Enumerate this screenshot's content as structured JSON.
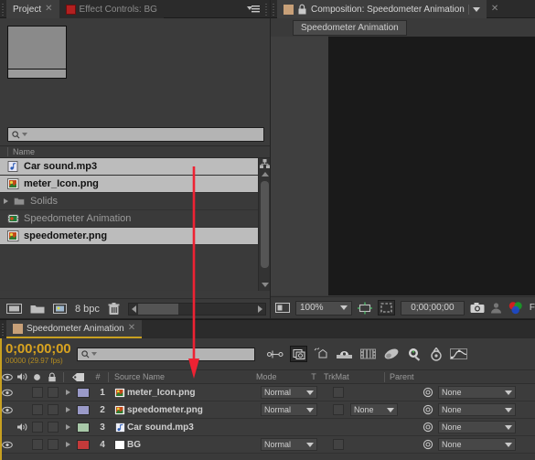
{
  "project": {
    "tabs": [
      {
        "label": "Project",
        "closable": true,
        "active": true,
        "icon": null
      },
      {
        "label": "Effect Controls: BG",
        "closable": false,
        "active": false,
        "icon": "red-square-icon"
      }
    ],
    "panel_menu_icon": "panel-menu-icon",
    "search": {
      "placeholder": "",
      "value": "",
      "icon": "search-icon"
    },
    "column_header": "Name",
    "items": [
      {
        "name": "Car sound.mp3",
        "icon": "audio-file-icon",
        "selected": true,
        "folder": false
      },
      {
        "name": "meter_Icon.png",
        "icon": "image-file-icon",
        "selected": true,
        "folder": false
      },
      {
        "name": "Solids",
        "icon": "folder-icon",
        "selected": false,
        "folder": true
      },
      {
        "name": "Speedometer Animation",
        "icon": "composition-icon",
        "selected": false,
        "folder": false
      },
      {
        "name": "speedometer.png",
        "icon": "image-file-icon",
        "selected": true,
        "folder": false
      }
    ],
    "footer": {
      "new_comp_icon": "new-composition-icon",
      "new_folder_icon": "new-folder-icon",
      "interpret_icon": "interpret-footage-icon",
      "bit_depth": "8 bpc",
      "delete_icon": "delete-icon"
    }
  },
  "composition": {
    "tabs": [
      {
        "label": "Composition: Speedometer Animation",
        "active": true,
        "lock_icon": "lock-icon",
        "swatch": "comp-swatch-icon"
      }
    ],
    "breadcrumb": "Speedometer Animation",
    "footer": {
      "view_layout_icon": "view-layout-icon",
      "zoom": "100%",
      "region_icon": "region-of-interest-icon",
      "mask_icon": "mask-view-icon",
      "timecode": "0;00;00;00",
      "snapshot_icon": "snapshot-camera-icon",
      "show_snapshot_icon": "show-snapshot-icon",
      "channel_icon": "color-channel-icon",
      "resolution": "F"
    }
  },
  "timeline": {
    "tabs": [
      {
        "label": "Speedometer Animation",
        "active": true,
        "closable": true
      }
    ],
    "timecode": "0;00;00;00",
    "frames": "00000 (29.97 fps)",
    "search": {
      "placeholder": "",
      "value": "",
      "icon": "search-icon"
    },
    "toolbar_icons": [
      "composition-mini-flowchart-icon",
      "draft-3d-icon",
      "motion-blur-switch-icon",
      "shy-layers-icon",
      "frame-blending-icon",
      "motion-blur-icon",
      "brainstorm-icon",
      "auto-keyframe-icon",
      "graph-editor-icon"
    ],
    "columns": {
      "video_icon": "eye-icon",
      "audio_icon": "speaker-icon",
      "solo_icon": "solo-icon",
      "lock_icon": "lock-icon",
      "label_icon": "label-tag-icon",
      "index": "#",
      "source_name": "Source Name",
      "mode": "Mode",
      "t": "T",
      "trkmat": "TrkMat",
      "parent": "Parent"
    },
    "layers": [
      {
        "index": "1",
        "name": "meter_Icon.png",
        "icon": "image-file-icon",
        "label_color": "#9a9ac8",
        "video": true,
        "audio": false,
        "mode": "Normal",
        "trkmat": null,
        "parent": "None",
        "has_t": true
      },
      {
        "index": "2",
        "name": "speedometer.png",
        "icon": "image-file-icon",
        "label_color": "#9a9ac8",
        "video": true,
        "audio": false,
        "mode": "Normal",
        "trkmat": "None",
        "parent": "None",
        "has_t": true
      },
      {
        "index": "3",
        "name": "Car sound.mp3",
        "icon": "audio-file-icon",
        "label_color": "#a8c8a8",
        "video": false,
        "audio": true,
        "mode": null,
        "trkmat": null,
        "parent": "None",
        "has_t": false
      },
      {
        "index": "4",
        "name": "BG",
        "icon": "solid-white-icon",
        "label_color": "#c43a3a",
        "video": true,
        "audio": false,
        "mode": "Normal",
        "trkmat": null,
        "parent": "None",
        "has_t": true
      }
    ]
  },
  "annotation": {
    "arrow_color": "#ee2233",
    "direction": "down"
  }
}
